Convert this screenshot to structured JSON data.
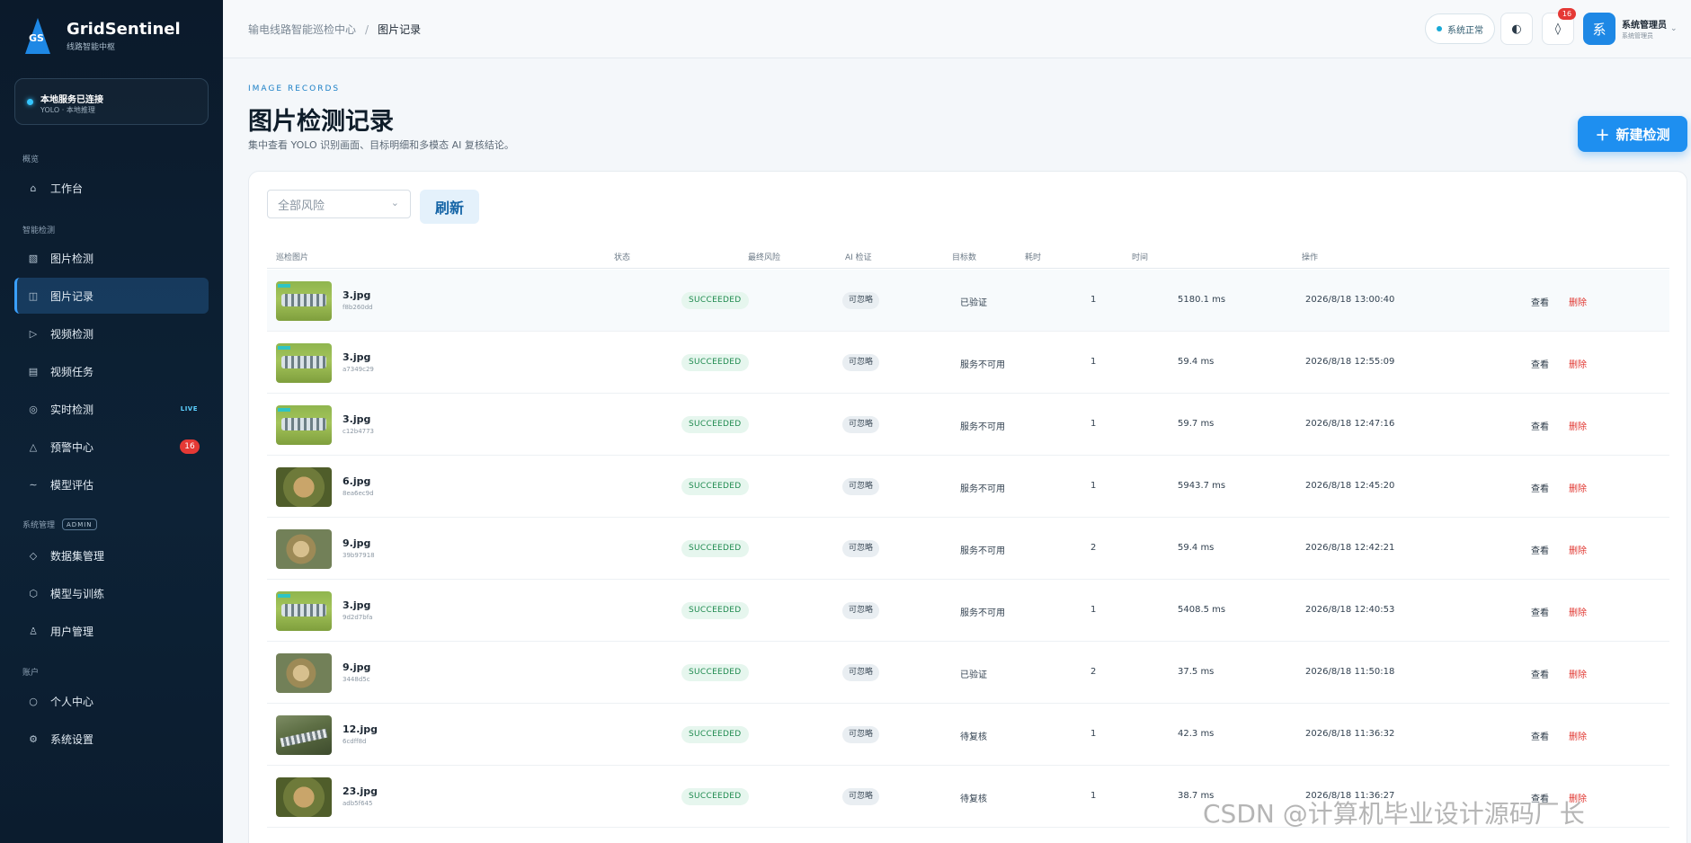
{
  "app": {
    "title": "GridSentinel",
    "subtitle": "线路智能中枢",
    "logo_text": "GS"
  },
  "service": {
    "title": "本地服务已连接",
    "sub": "YOLO · 本地推理"
  },
  "sidebar": {
    "sections": {
      "overview": "概览",
      "detect": "智能检测",
      "system": "系统管理",
      "admin_tag": "ADMIN",
      "account": "账户"
    },
    "items": [
      {
        "label": "工作台",
        "icon": "home-icon",
        "glyph": "⌂"
      },
      {
        "label": "图片检测",
        "icon": "image-icon",
        "glyph": "▧"
      },
      {
        "label": "图片记录",
        "icon": "records-icon",
        "glyph": "◫"
      },
      {
        "label": "视频检测",
        "icon": "play-icon",
        "glyph": "▷"
      },
      {
        "label": "视频任务",
        "icon": "task-icon",
        "glyph": "▤"
      },
      {
        "label": "实时检测",
        "icon": "target-icon",
        "glyph": "◎",
        "tag": "LIVE"
      },
      {
        "label": "预警中心",
        "icon": "alert-icon",
        "glyph": "△",
        "badge": "16"
      },
      {
        "label": "模型评估",
        "icon": "wave-icon",
        "glyph": "∼"
      },
      {
        "label": "数据集管理",
        "icon": "dataset-icon",
        "glyph": "◇"
      },
      {
        "label": "模型与训练",
        "icon": "cube-icon",
        "glyph": "⬡"
      },
      {
        "label": "用户管理",
        "icon": "user-icon",
        "glyph": "♙"
      },
      {
        "label": "个人中心",
        "icon": "profile-icon",
        "glyph": "○"
      },
      {
        "label": "系统设置",
        "icon": "settings-icon",
        "glyph": "⚙"
      }
    ]
  },
  "header": {
    "breadcrumb": [
      "输电线路智能巡检中心",
      "图片记录"
    ],
    "status": "系统正常",
    "theme_icon": "◐",
    "bell_icon": "◊",
    "bell_count": "16",
    "user": {
      "avatar": "系",
      "name": "系统管理员",
      "role": "系统管理员"
    }
  },
  "page": {
    "eyebrow": "IMAGE RECORDS",
    "title": "图片检测记录",
    "desc": "集中查看 YOLO 识别画面、目标明细和多模态 AI 复核结论。",
    "new_button": "新建检测"
  },
  "filters": {
    "risk_placeholder": "全部风险",
    "refresh": "刷新"
  },
  "table": {
    "columns": [
      "巡检图片",
      "状态",
      "最终风险",
      "AI 检证",
      "目标数",
      "耗时",
      "时间",
      "操作"
    ],
    "actions": {
      "view": "查看",
      "delete": "删除"
    },
    "rows": [
      {
        "file": "3.jpg",
        "id": "f8b260dd",
        "status": "SUCCEEDED",
        "risk": "可忽略",
        "ai": "已验证",
        "count": "1",
        "duration": "5180.1 ms",
        "time": "2026/8/18 13:00:40",
        "thumb": "ins"
      },
      {
        "file": "3.jpg",
        "id": "a7349c29",
        "status": "SUCCEEDED",
        "risk": "可忽略",
        "ai": "服务不可用",
        "count": "1",
        "duration": "59.4 ms",
        "time": "2026/8/18 12:55:09",
        "thumb": "ins"
      },
      {
        "file": "3.jpg",
        "id": "c12b4773",
        "status": "SUCCEEDED",
        "risk": "可忽略",
        "ai": "服务不可用",
        "count": "1",
        "duration": "59.7 ms",
        "time": "2026/8/18 12:47:16",
        "thumb": "ins"
      },
      {
        "file": "6.jpg",
        "id": "8ea6ec9d",
        "status": "SUCCEEDED",
        "risk": "可忽略",
        "ai": "服务不可用",
        "count": "1",
        "duration": "5943.7 ms",
        "time": "2026/8/18 12:45:20",
        "thumb": "bird"
      },
      {
        "file": "9.jpg",
        "id": "39b97918",
        "status": "SUCCEEDED",
        "risk": "可忽略",
        "ai": "服务不可用",
        "count": "2",
        "duration": "59.4 ms",
        "time": "2026/8/18 12:42:21",
        "thumb": "coil"
      },
      {
        "file": "3.jpg",
        "id": "9d2d7bfa",
        "status": "SUCCEEDED",
        "risk": "可忽略",
        "ai": "服务不可用",
        "count": "1",
        "duration": "5408.5 ms",
        "time": "2026/8/18 12:40:53",
        "thumb": "ins"
      },
      {
        "file": "9.jpg",
        "id": "3448d5c",
        "status": "SUCCEEDED",
        "risk": "可忽略",
        "ai": "已验证",
        "count": "2",
        "duration": "37.5 ms",
        "time": "2026/8/18 11:50:18",
        "thumb": "coil"
      },
      {
        "file": "12.jpg",
        "id": "6cdff8d",
        "status": "SUCCEEDED",
        "risk": "可忽略",
        "ai": "待复核",
        "count": "1",
        "duration": "42.3 ms",
        "time": "2026/8/18 11:36:32",
        "thumb": "tree"
      },
      {
        "file": "23.jpg",
        "id": "adb5f645",
        "status": "SUCCEEDED",
        "risk": "可忽略",
        "ai": "待复核",
        "count": "1",
        "duration": "38.7 ms",
        "time": "2026/8/18 11:36:27",
        "thumb": "bird"
      }
    ]
  },
  "watermark": "CSDN @计算机毕业设计源码厂长"
}
